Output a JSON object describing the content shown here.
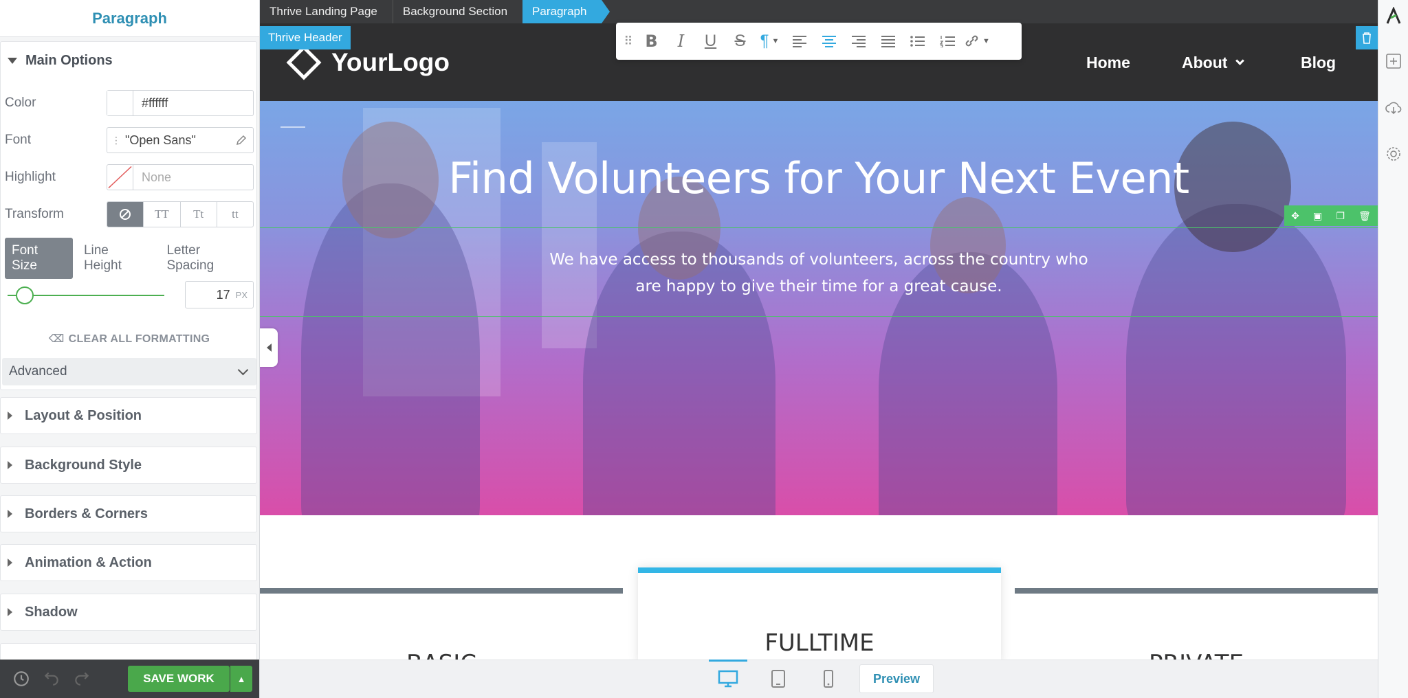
{
  "sidebar": {
    "title": "Paragraph",
    "main_options": "Main Options",
    "color_label": "Color",
    "color_value": "#ffffff",
    "font_label": "Font",
    "font_value": "\"Open Sans\"",
    "highlight_label": "Highlight",
    "highlight_value": "None",
    "transform_label": "Transform",
    "transform_options": [
      "TT",
      "Tt",
      "tt"
    ],
    "size_tabs": [
      "Font Size",
      "Line Height",
      "Letter Spacing"
    ],
    "font_size": "17",
    "font_size_unit": "PX",
    "clear_formatting": "CLEAR ALL FORMATTING",
    "advanced": "Advanced",
    "sections": [
      "Layout & Position",
      "Background Style",
      "Borders & Corners",
      "Animation & Action",
      "Shadow"
    ],
    "save_label": "SAVE WORK"
  },
  "breadcrumbs": [
    "Thrive Landing Page",
    "Background Section",
    "Paragraph"
  ],
  "header": {
    "tag": "Thrive Header",
    "logo_text": "YourLogo",
    "nav": [
      "Home",
      "About",
      "Blog"
    ]
  },
  "hero": {
    "title": "Find Volunteers for Your Next Event",
    "paragraph": "We have access to thousands of volunteers, across the country who are happy to give their time for a great cause."
  },
  "pricing": {
    "cards": [
      "BASIC",
      "FULLTIME",
      "PRIVATE"
    ]
  },
  "bottom": {
    "preview": "Preview"
  },
  "colors": {
    "accent": "#33a9df",
    "save": "#4aa84b",
    "selection": "#4cc26a"
  }
}
